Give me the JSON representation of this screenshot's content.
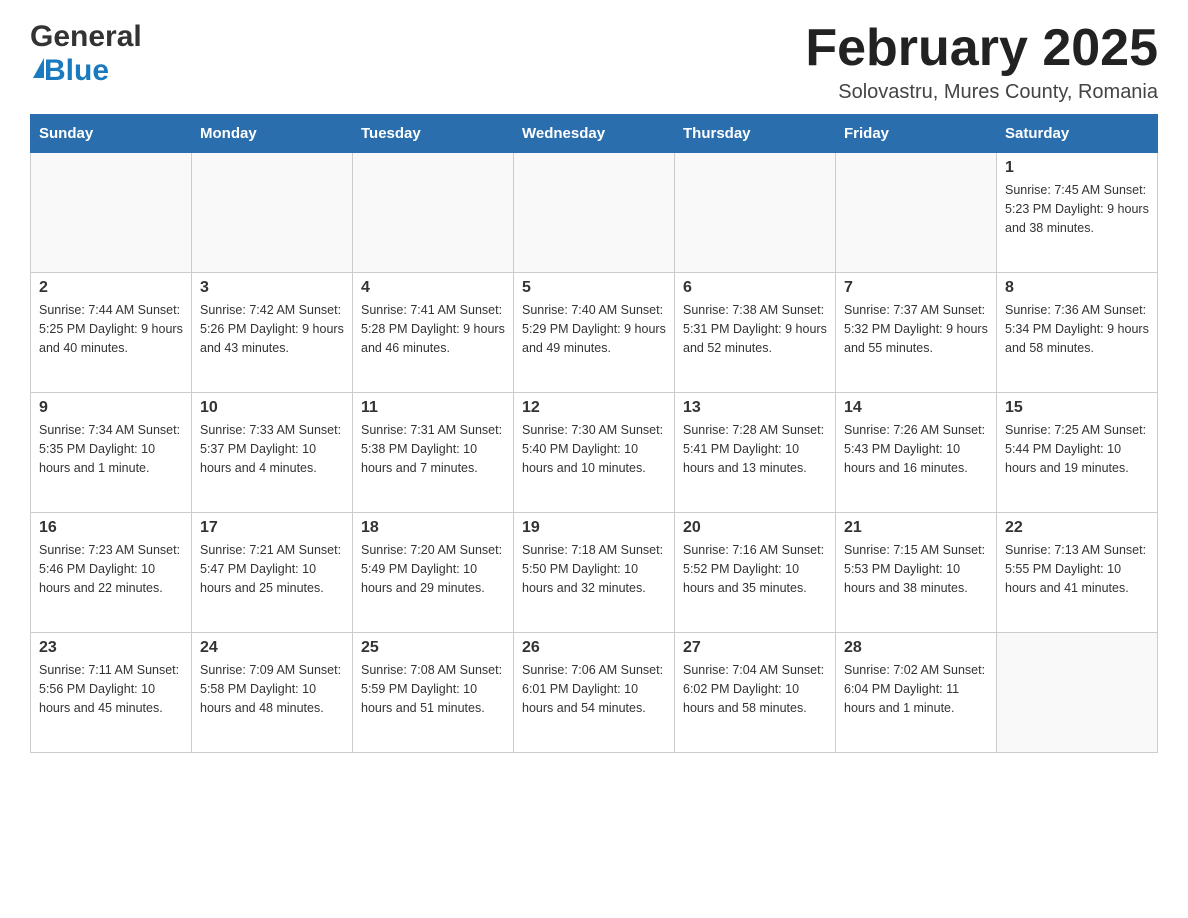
{
  "header": {
    "logo_general": "General",
    "logo_blue": "Blue",
    "month_title": "February 2025",
    "location": "Solovastru, Mures County, Romania"
  },
  "weekdays": [
    "Sunday",
    "Monday",
    "Tuesday",
    "Wednesday",
    "Thursday",
    "Friday",
    "Saturday"
  ],
  "weeks": [
    [
      {
        "day": "",
        "info": ""
      },
      {
        "day": "",
        "info": ""
      },
      {
        "day": "",
        "info": ""
      },
      {
        "day": "",
        "info": ""
      },
      {
        "day": "",
        "info": ""
      },
      {
        "day": "",
        "info": ""
      },
      {
        "day": "1",
        "info": "Sunrise: 7:45 AM\nSunset: 5:23 PM\nDaylight: 9 hours and 38 minutes."
      }
    ],
    [
      {
        "day": "2",
        "info": "Sunrise: 7:44 AM\nSunset: 5:25 PM\nDaylight: 9 hours and 40 minutes."
      },
      {
        "day": "3",
        "info": "Sunrise: 7:42 AM\nSunset: 5:26 PM\nDaylight: 9 hours and 43 minutes."
      },
      {
        "day": "4",
        "info": "Sunrise: 7:41 AM\nSunset: 5:28 PM\nDaylight: 9 hours and 46 minutes."
      },
      {
        "day": "5",
        "info": "Sunrise: 7:40 AM\nSunset: 5:29 PM\nDaylight: 9 hours and 49 minutes."
      },
      {
        "day": "6",
        "info": "Sunrise: 7:38 AM\nSunset: 5:31 PM\nDaylight: 9 hours and 52 minutes."
      },
      {
        "day": "7",
        "info": "Sunrise: 7:37 AM\nSunset: 5:32 PM\nDaylight: 9 hours and 55 minutes."
      },
      {
        "day": "8",
        "info": "Sunrise: 7:36 AM\nSunset: 5:34 PM\nDaylight: 9 hours and 58 minutes."
      }
    ],
    [
      {
        "day": "9",
        "info": "Sunrise: 7:34 AM\nSunset: 5:35 PM\nDaylight: 10 hours and 1 minute."
      },
      {
        "day": "10",
        "info": "Sunrise: 7:33 AM\nSunset: 5:37 PM\nDaylight: 10 hours and 4 minutes."
      },
      {
        "day": "11",
        "info": "Sunrise: 7:31 AM\nSunset: 5:38 PM\nDaylight: 10 hours and 7 minutes."
      },
      {
        "day": "12",
        "info": "Sunrise: 7:30 AM\nSunset: 5:40 PM\nDaylight: 10 hours and 10 minutes."
      },
      {
        "day": "13",
        "info": "Sunrise: 7:28 AM\nSunset: 5:41 PM\nDaylight: 10 hours and 13 minutes."
      },
      {
        "day": "14",
        "info": "Sunrise: 7:26 AM\nSunset: 5:43 PM\nDaylight: 10 hours and 16 minutes."
      },
      {
        "day": "15",
        "info": "Sunrise: 7:25 AM\nSunset: 5:44 PM\nDaylight: 10 hours and 19 minutes."
      }
    ],
    [
      {
        "day": "16",
        "info": "Sunrise: 7:23 AM\nSunset: 5:46 PM\nDaylight: 10 hours and 22 minutes."
      },
      {
        "day": "17",
        "info": "Sunrise: 7:21 AM\nSunset: 5:47 PM\nDaylight: 10 hours and 25 minutes."
      },
      {
        "day": "18",
        "info": "Sunrise: 7:20 AM\nSunset: 5:49 PM\nDaylight: 10 hours and 29 minutes."
      },
      {
        "day": "19",
        "info": "Sunrise: 7:18 AM\nSunset: 5:50 PM\nDaylight: 10 hours and 32 minutes."
      },
      {
        "day": "20",
        "info": "Sunrise: 7:16 AM\nSunset: 5:52 PM\nDaylight: 10 hours and 35 minutes."
      },
      {
        "day": "21",
        "info": "Sunrise: 7:15 AM\nSunset: 5:53 PM\nDaylight: 10 hours and 38 minutes."
      },
      {
        "day": "22",
        "info": "Sunrise: 7:13 AM\nSunset: 5:55 PM\nDaylight: 10 hours and 41 minutes."
      }
    ],
    [
      {
        "day": "23",
        "info": "Sunrise: 7:11 AM\nSunset: 5:56 PM\nDaylight: 10 hours and 45 minutes."
      },
      {
        "day": "24",
        "info": "Sunrise: 7:09 AM\nSunset: 5:58 PM\nDaylight: 10 hours and 48 minutes."
      },
      {
        "day": "25",
        "info": "Sunrise: 7:08 AM\nSunset: 5:59 PM\nDaylight: 10 hours and 51 minutes."
      },
      {
        "day": "26",
        "info": "Sunrise: 7:06 AM\nSunset: 6:01 PM\nDaylight: 10 hours and 54 minutes."
      },
      {
        "day": "27",
        "info": "Sunrise: 7:04 AM\nSunset: 6:02 PM\nDaylight: 10 hours and 58 minutes."
      },
      {
        "day": "28",
        "info": "Sunrise: 7:02 AM\nSunset: 6:04 PM\nDaylight: 11 hours and 1 minute."
      },
      {
        "day": "",
        "info": ""
      }
    ]
  ]
}
